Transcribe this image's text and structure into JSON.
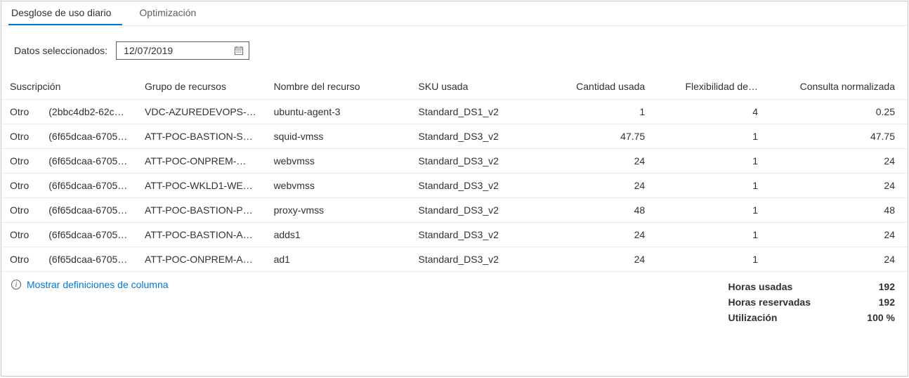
{
  "tabs": {
    "daily": "Desglose de uso diario",
    "optimization": "Optimización"
  },
  "filter": {
    "label": "Datos seleccionados:",
    "date_value": "12/07/2019"
  },
  "columns": {
    "subscription": "Suscripción",
    "resource_group": "Grupo de recursos",
    "resource_name": "Nombre del recurso",
    "sku_used": "SKU usada",
    "qty_used": "Cantidad usada",
    "flexibility": "Flexibilidad de…",
    "normalized": "Consulta normalizada"
  },
  "rows": [
    {
      "tag": "Otro",
      "sub": "(2bbc4db2-62c…",
      "rg": "VDC-AZUREDEVOPS-…",
      "res": "ubuntu-agent-3",
      "sku": "Standard_DS1_v2",
      "qty": "1",
      "flex": "4",
      "norm": "0.25"
    },
    {
      "tag": "Otro",
      "sub": "(6f65dcaa-6705…",
      "rg": "ATT-POC-BASTION-S…",
      "res": "squid-vmss",
      "sku": "Standard_DS3_v2",
      "qty": "47.75",
      "flex": "1",
      "norm": "47.75"
    },
    {
      "tag": "Otro",
      "sub": "(6f65dcaa-6705…",
      "rg": "ATT-POC-ONPREM-…",
      "res": "webvmss",
      "sku": "Standard_DS3_v2",
      "qty": "24",
      "flex": "1",
      "norm": "24"
    },
    {
      "tag": "Otro",
      "sub": "(6f65dcaa-6705…",
      "rg": "ATT-POC-WKLD1-WE…",
      "res": "webvmss",
      "sku": "Standard_DS3_v2",
      "qty": "24",
      "flex": "1",
      "norm": "24"
    },
    {
      "tag": "Otro",
      "sub": "(6f65dcaa-6705…",
      "rg": "ATT-POC-BASTION-P…",
      "res": "proxy-vmss",
      "sku": "Standard_DS3_v2",
      "qty": "48",
      "flex": "1",
      "norm": "48"
    },
    {
      "tag": "Otro",
      "sub": "(6f65dcaa-6705…",
      "rg": "ATT-POC-BASTION-A…",
      "res": "adds1",
      "sku": "Standard_DS3_v2",
      "qty": "24",
      "flex": "1",
      "norm": "24"
    },
    {
      "tag": "Otro",
      "sub": "(6f65dcaa-6705…",
      "rg": "ATT-POC-ONPREM-A…",
      "res": "ad1",
      "sku": "Standard_DS3_v2",
      "qty": "24",
      "flex": "1",
      "norm": "24"
    }
  ],
  "footer": {
    "defs_link": "Mostrar definiciones de columna",
    "summary": {
      "hours_used_label": "Horas usadas",
      "hours_used_value": "192",
      "hours_reserved_label": "Horas reservadas",
      "hours_reserved_value": "192",
      "utilization_label": "Utilización",
      "utilization_value": "100 %"
    }
  }
}
